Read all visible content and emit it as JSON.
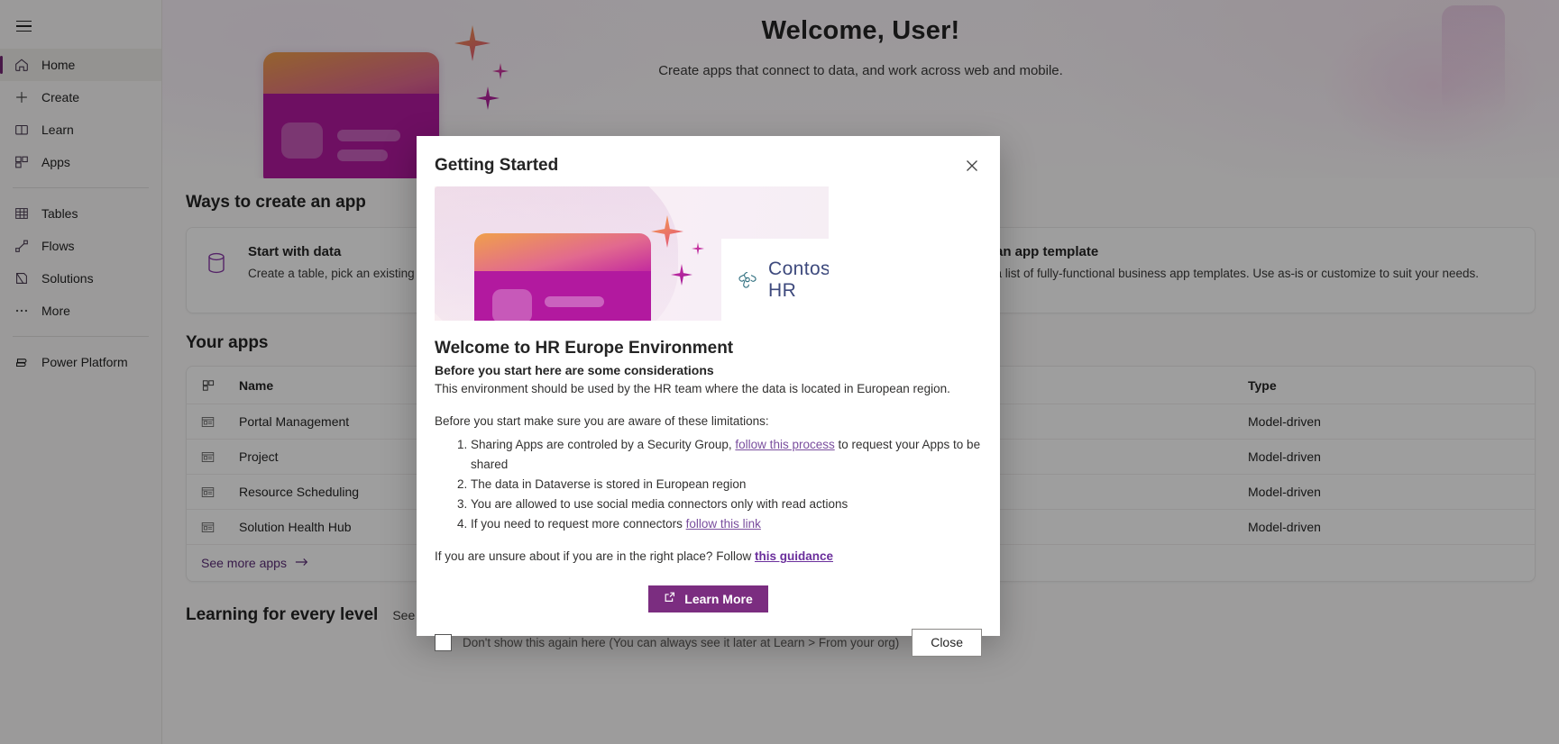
{
  "sidebar": {
    "hamburger_name": "hamburger-menu",
    "items": [
      {
        "label": "Home",
        "icon": "home-icon",
        "active": true
      },
      {
        "label": "Create",
        "icon": "plus-icon",
        "active": false
      },
      {
        "label": "Learn",
        "icon": "book-icon",
        "active": false
      },
      {
        "label": "Apps",
        "icon": "apps-grid-icon",
        "active": false
      },
      {
        "label": "Tables",
        "icon": "table-icon",
        "active": false
      },
      {
        "label": "Flows",
        "icon": "flow-icon",
        "active": false
      },
      {
        "label": "Solutions",
        "icon": "solutions-icon",
        "active": false
      },
      {
        "label": "More",
        "icon": "ellipsis-icon",
        "active": false
      },
      {
        "label": "Power Platform",
        "icon": "power-platform-icon",
        "active": false
      }
    ]
  },
  "hero": {
    "title": "Welcome, User!",
    "subtitle": "Create apps that connect to data, and work across web and mobile."
  },
  "ways": {
    "heading": "Ways to create an app",
    "cards": [
      {
        "title": "Start with data",
        "desc": "Create a table, pick an existing one, or import from Excel to create an app.",
        "icon": "database-icon"
      },
      {
        "title": "Start with an app template",
        "desc": "Select from a list of fully-functional business app templates. Use as-is or customize to suit your needs.",
        "icon": "app-template-icon"
      }
    ]
  },
  "your_apps": {
    "heading": "Your apps",
    "columns": [
      "Name",
      "Type"
    ],
    "header_icon": "apps-grid-icon",
    "rows": [
      {
        "name": "Portal Management",
        "type": "Model-driven",
        "icon": "model-driven-app-icon"
      },
      {
        "name": "Project",
        "type": "Model-driven",
        "icon": "model-driven-app-icon"
      },
      {
        "name": "Resource Scheduling",
        "type": "Model-driven",
        "icon": "model-driven-app-icon"
      },
      {
        "name": "Solution Health Hub",
        "type": "Model-driven",
        "icon": "model-driven-app-icon"
      }
    ],
    "see_more": "See more apps",
    "see_more_icon": "arrow-right-icon"
  },
  "learning": {
    "heading": "Learning for every level",
    "see_all": "See all"
  },
  "dialog": {
    "title": "Getting Started",
    "close_icon": "close-icon",
    "banner": {
      "logo_text": "Contoso HR",
      "logo_icon": "contoso-logo-icon"
    },
    "welcome_heading": "Welcome to HR Europe Environment",
    "welcome_subheading": "Before you start here are some considerations",
    "intro": "This environment should be used by the HR team where the data is located in European region.",
    "limitations_intro": "Before you start make sure you are aware of these limitations:",
    "limitations": [
      {
        "pre": "Sharing Apps are controled by a Security Group, ",
        "link": "follow this process",
        "post": " to request your Apps to be shared"
      },
      {
        "pre": "The data in Dataverse is stored in European region",
        "link": "",
        "post": ""
      },
      {
        "pre": "You are allowed to use social media connectors only with read actions",
        "link": "",
        "post": ""
      },
      {
        "pre": "If you need to request more connectors ",
        "link": "follow this link",
        "post": ""
      }
    ],
    "guidance_pre": "If you are unsure about if you are in the right place? Follow ",
    "guidance_link": "this guidance",
    "learn_more_label": "Learn More",
    "learn_more_icon": "external-link-icon",
    "checkbox_label": "Don't show this again here (You can always see it later at Learn > From your org)",
    "checkbox_checked": false,
    "close_label": "Close"
  },
  "colors": {
    "accent_purple": "#7b2d80",
    "active_bar": "#742774",
    "link_purple": "#7a4e9e",
    "text_primary": "#242424"
  }
}
